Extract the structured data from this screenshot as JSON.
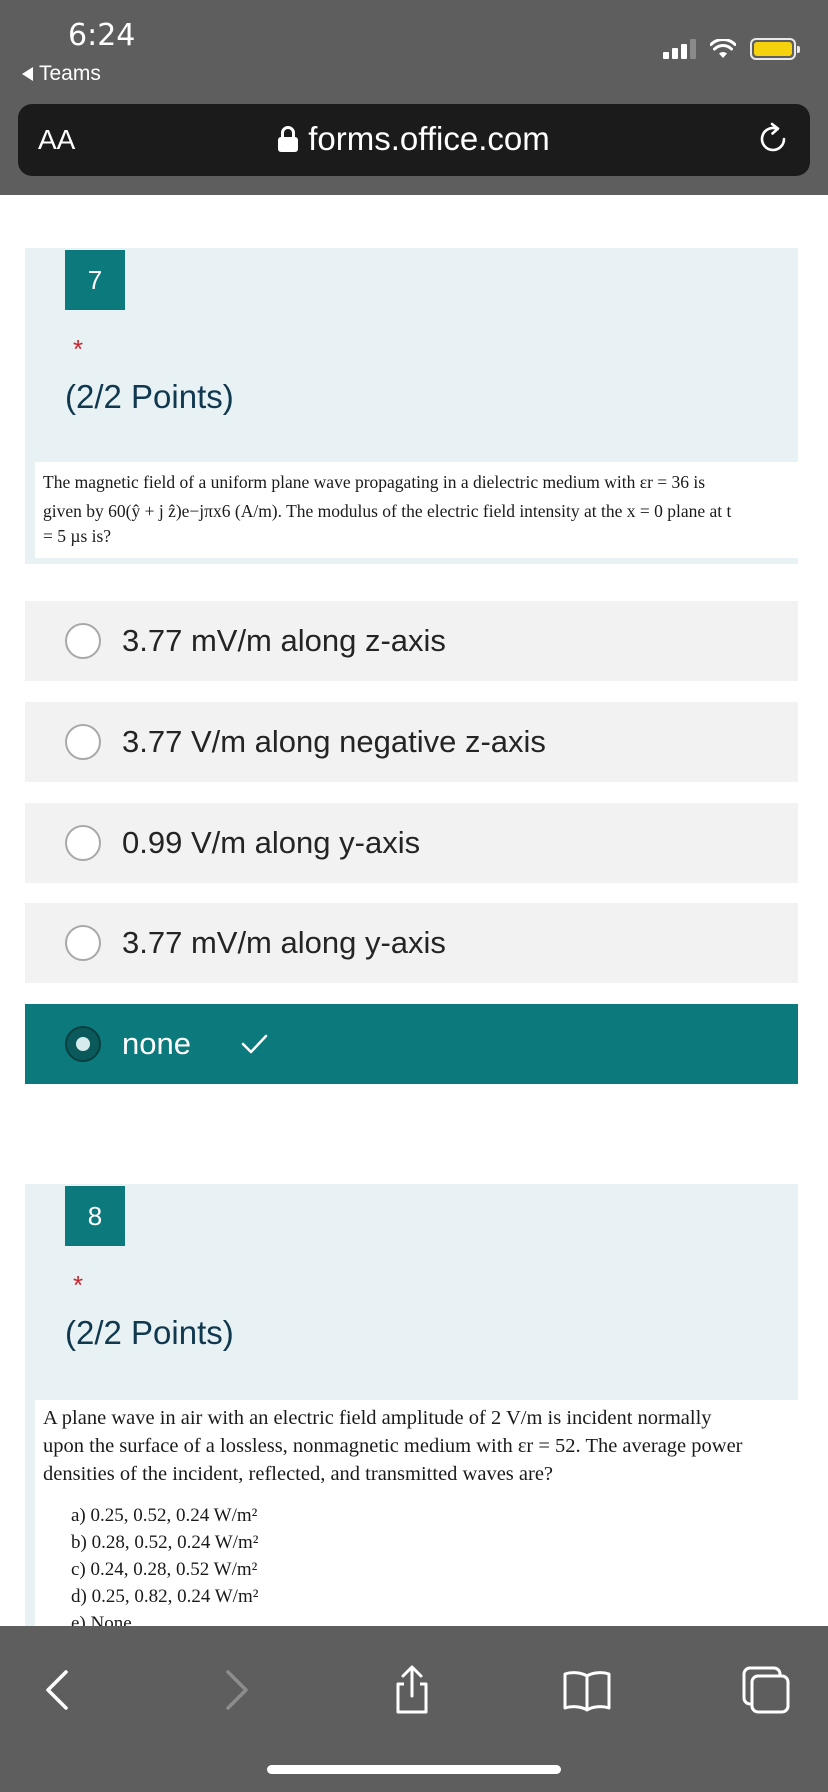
{
  "status_bar": {
    "time": "6:24",
    "back_app": "Teams"
  },
  "browser": {
    "text_size_label": "AA",
    "url": "forms.office.com"
  },
  "questions": [
    {
      "number": "7",
      "required_mark": "*",
      "points": "(2/2 Points)",
      "text_line1": "The magnetic field of a uniform plane wave propagating in a dielectric medium with εr = 36 is",
      "text_line2": "given by 60(ŷ + j ẑ)e−jπx6 (A/m). The modulus of the electric field intensity at the x = 0 plane at t",
      "text_line3": "= 5 µs is?",
      "options": [
        {
          "label": "3.77 mV/m along z-axis",
          "selected": false
        },
        {
          "label": "3.77 V/m along negative z-axis",
          "selected": false
        },
        {
          "label": "0.99 V/m along y-axis",
          "selected": false
        },
        {
          "label": "3.77 mV/m along y-axis",
          "selected": false
        },
        {
          "label": "none",
          "selected": true
        }
      ]
    },
    {
      "number": "8",
      "required_mark": "*",
      "points": "(2/2 Points)",
      "text_line1": "A plane wave in air with an electric field amplitude of 2 V/m is incident normally",
      "text_line2": "upon the surface of a lossless, nonmagnetic medium with εr = 52. The average power",
      "text_line3": "densities of the incident, reflected, and transmitted waves are?",
      "choices": [
        "a)  0.25, 0.52, 0.24 W/m²",
        "b)  0.28, 0.52, 0.24 W/m²",
        "c)  0.24, 0.28, 0.52 W/m²",
        "d)  0.25, 0.82, 0.24 W/m²",
        "e)  None"
      ]
    }
  ],
  "toolbar": {
    "icons": [
      "back-chevron-icon",
      "forward-chevron-icon",
      "share-icon",
      "bookmarks-icon",
      "tabs-icon"
    ]
  },
  "colors": {
    "accent": "#0c7a7c",
    "question_bg": "#e8f1f3",
    "option_bg": "#f2f2f2",
    "chrome_bg": "#5e5e5e"
  }
}
